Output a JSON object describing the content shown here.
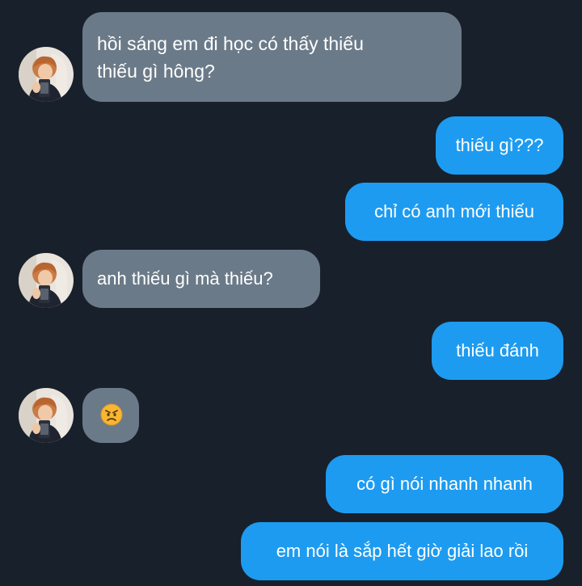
{
  "messages": [
    {
      "from": "them",
      "lines": [
        "hồi sáng em đi học có thấy thiếu",
        "thiếu gì hông?"
      ]
    },
    {
      "from": "me",
      "text": "thiếu gì???"
    },
    {
      "from": "me",
      "text": "chỉ có anh mới thiếu"
    },
    {
      "from": "them",
      "text": "anh thiếu gì mà thiếu?"
    },
    {
      "from": "me",
      "text": "thiếu đánh"
    },
    {
      "from": "them",
      "emoji": "angry-face",
      "text": "😠"
    },
    {
      "from": "me",
      "text": "có gì nói nhanh nhanh"
    },
    {
      "from": "me",
      "text": "em nói là sắp hết giờ giải lao rồi"
    }
  ],
  "colors": {
    "background": "#18202b",
    "incoming_bubble": "#6b7a88",
    "outgoing_bubble": "#1d9bf0",
    "text": "#ffffff"
  }
}
